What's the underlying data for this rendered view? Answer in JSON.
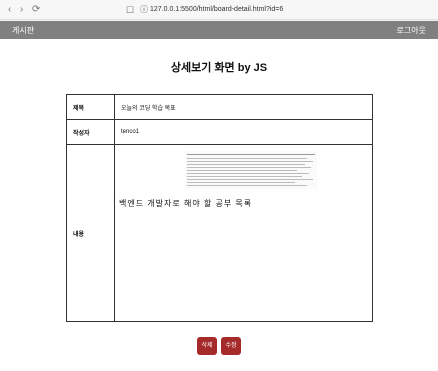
{
  "browser": {
    "back": "‹",
    "forward": "›",
    "reload": "⟳",
    "bookmark": "☐",
    "info": "ⓘ",
    "url": "127.0.0.1:5500/html/board-detail.html?id=6"
  },
  "topbar": {
    "brand": "게시판",
    "logout": "로그아웃"
  },
  "page": {
    "title": "상세보기 화면 by JS"
  },
  "table": {
    "title_label": "제목",
    "title_value": "오늘의 코딩 학습 목표",
    "author_label": "작성자",
    "author_value": "tenco1",
    "content_label": "내용",
    "content_text": "백엔드 개발자로 해야 할 공부 목록"
  },
  "buttons": {
    "delete": "삭제",
    "edit": "수정"
  }
}
